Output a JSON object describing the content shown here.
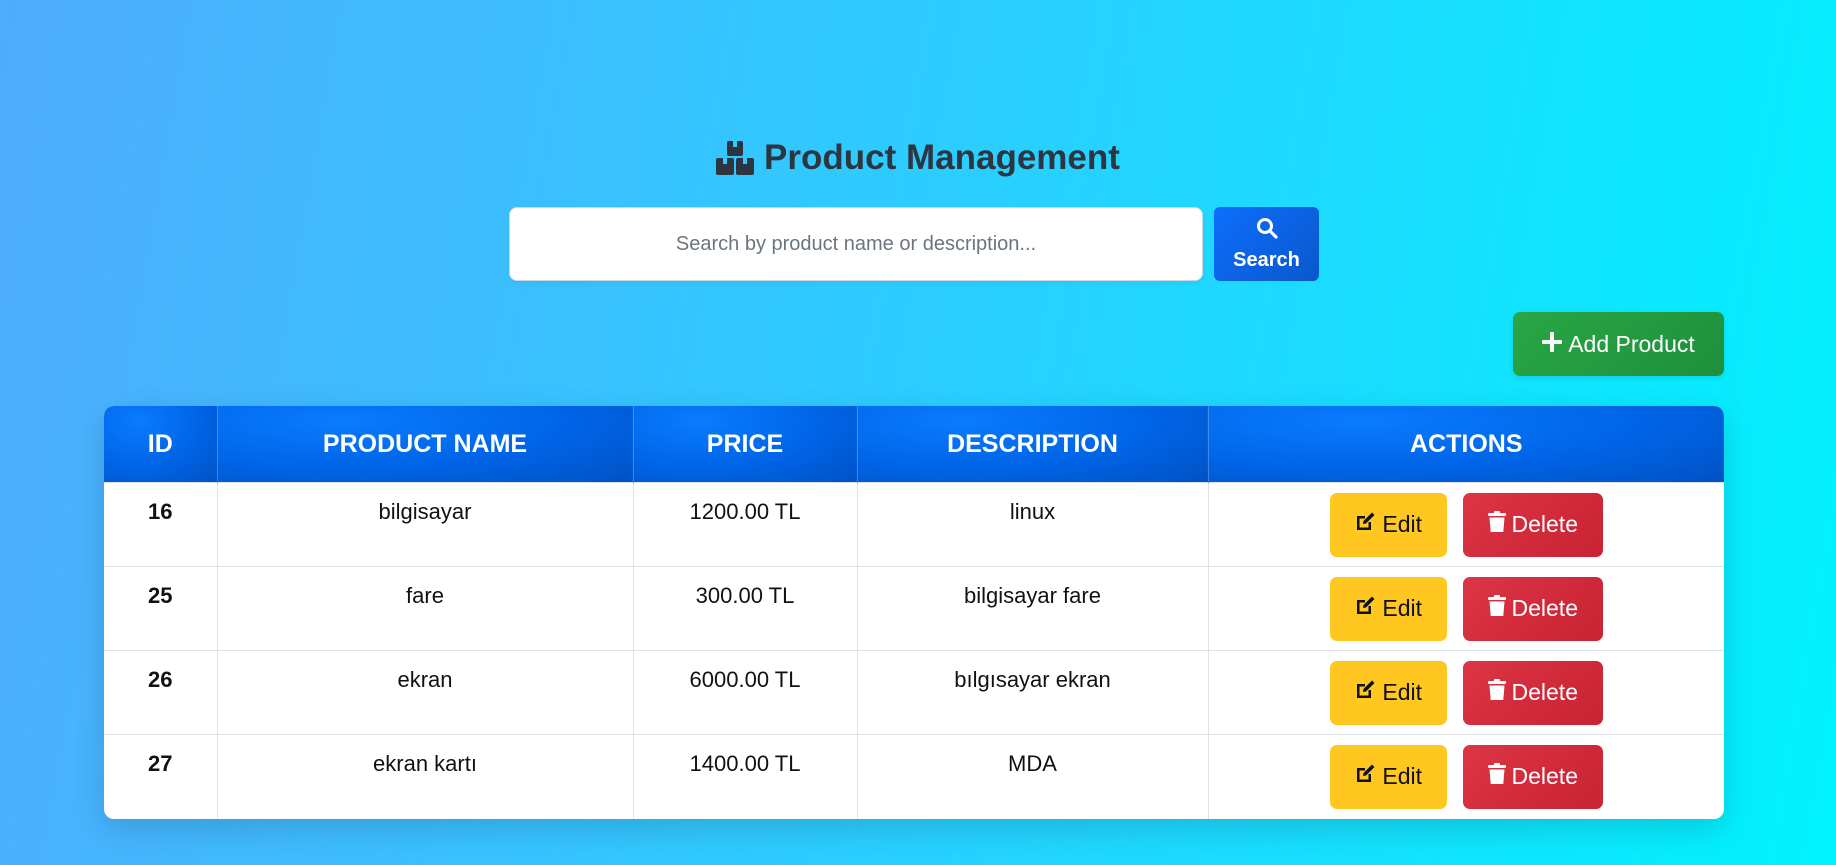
{
  "header": {
    "title": "Product Management",
    "icon": "boxes-icon"
  },
  "search": {
    "placeholder": "Search by product name or description...",
    "value": "",
    "button_label": "Search",
    "button_icon": "search-icon"
  },
  "add_button": {
    "label": "Add Product",
    "icon": "plus-icon"
  },
  "table": {
    "columns": [
      "ID",
      "PRODUCT NAME",
      "PRICE",
      "DESCRIPTION",
      "ACTIONS"
    ],
    "rows": [
      {
        "id": "16",
        "name": "bilgisayar",
        "price": "1200.00 TL",
        "description": "linux"
      },
      {
        "id": "25",
        "name": "fare",
        "price": "300.00 TL",
        "description": "bilgisayar fare"
      },
      {
        "id": "26",
        "name": "ekran",
        "price": "6000.00 TL",
        "description": "bılgısayar ekran"
      },
      {
        "id": "27",
        "name": "ekran kartı",
        "price": "1400.00 TL",
        "description": "MDA"
      }
    ],
    "edit_label": "Edit",
    "delete_label": "Delete"
  },
  "colors": {
    "primary": "#0d6efd",
    "success": "#28a745",
    "warning": "#ffc720",
    "danger": "#dc3545",
    "title_text": "#2d3640"
  }
}
